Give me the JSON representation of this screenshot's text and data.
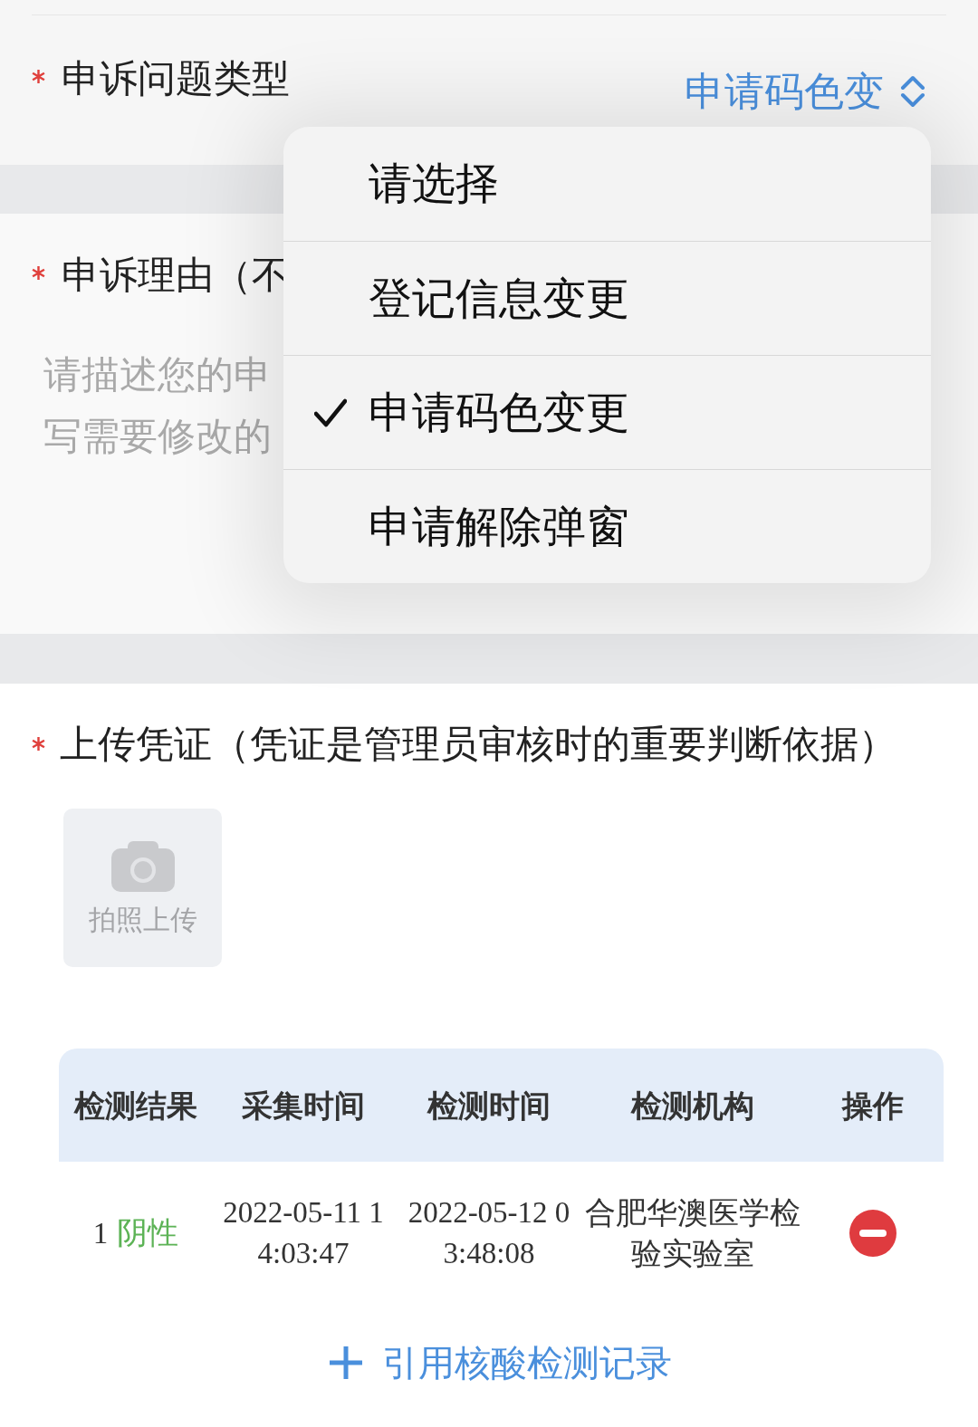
{
  "type_field": {
    "label": "申诉问题类型",
    "required": true,
    "value": "申请码色变"
  },
  "dropdown": {
    "options": [
      {
        "label": "请选择",
        "selected": false
      },
      {
        "label": "登记信息变更",
        "selected": false
      },
      {
        "label": "申请码色变更",
        "selected": true
      },
      {
        "label": "申请解除弹窗",
        "selected": false
      }
    ]
  },
  "reason_field": {
    "label": "申诉理由（不",
    "required": true,
    "placeholder": [
      "请描述您的申",
      "写需要修改的"
    ]
  },
  "evidence_field": {
    "label": "上传凭证（凭证是管理员审核时的重要判断依据）",
    "required": true,
    "upload_button": "拍照上传"
  },
  "table": {
    "columns": [
      "检测结果",
      "采集时间",
      "检测时间",
      "检测机构",
      "操作"
    ],
    "rows": [
      {
        "index": "1",
        "result": "阴性",
        "collection_time": "2022-05-11 14:03:47",
        "test_time": "2022-05-12 03:48:08",
        "institution": "合肥华澳医学检验实验室"
      }
    ]
  },
  "add_record_button": {
    "label": "引用核酸检测记录"
  }
}
